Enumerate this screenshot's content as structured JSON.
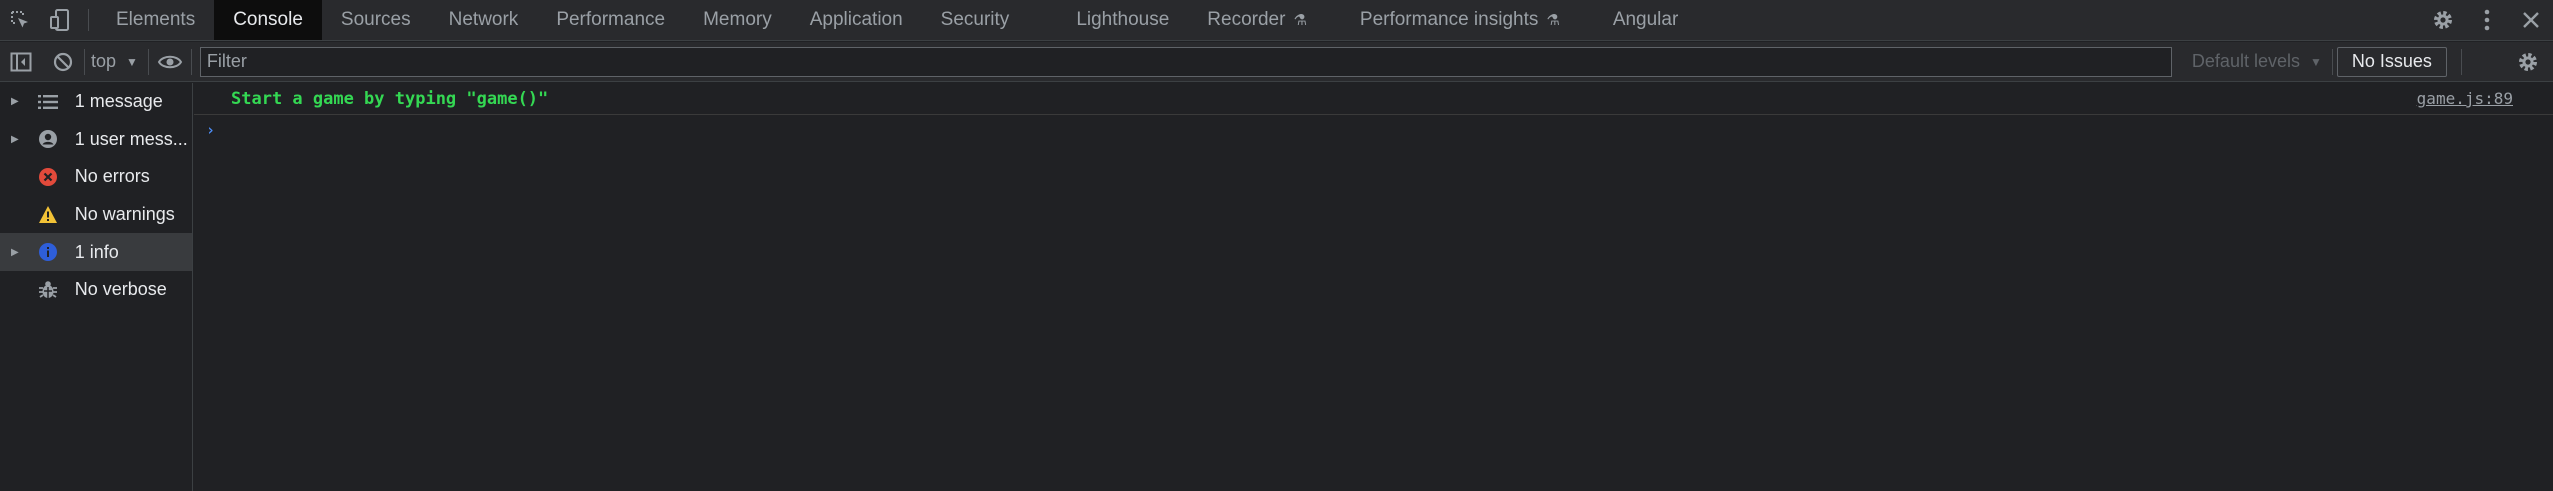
{
  "tabbar": {
    "tabs": [
      {
        "label": "Elements"
      },
      {
        "label": "Console",
        "active": true
      },
      {
        "label": "Sources"
      },
      {
        "label": "Network"
      },
      {
        "label": "Performance"
      },
      {
        "label": "Memory"
      },
      {
        "label": "Application"
      },
      {
        "label": "Security"
      },
      {
        "label": "Lighthouse"
      },
      {
        "label": "Recorder",
        "experimental": true
      },
      {
        "label": "Performance insights",
        "experimental": true
      },
      {
        "label": "Angular"
      }
    ],
    "left_icons": [
      "inspect-element-icon",
      "device-toolbar-icon"
    ],
    "right_icons": [
      "settings-gear-icon",
      "kebab-menu-icon",
      "close-icon"
    ]
  },
  "toolbar": {
    "context": "top",
    "filter_placeholder": "Filter",
    "filter_value": "",
    "levels": "Default levels",
    "issues": "No Issues"
  },
  "sidebar": {
    "items": [
      {
        "label": "1 message",
        "icon": "list-icon",
        "expandable": true
      },
      {
        "label": "1 user mess...",
        "icon": "user-icon",
        "expandable": true
      },
      {
        "label": "No errors",
        "icon": "error-icon",
        "expandable": false
      },
      {
        "label": "No warnings",
        "icon": "warning-icon",
        "expandable": false
      },
      {
        "label": "1 info",
        "icon": "info-icon",
        "expandable": true,
        "selected": true
      },
      {
        "label": "No verbose",
        "icon": "bug-icon",
        "expandable": false
      }
    ]
  },
  "console": {
    "messages": [
      {
        "text": "Start a game by typing \"game()\"",
        "source": "game.js:89"
      }
    ]
  },
  "colors": {
    "background": "#202124",
    "toolbar": "#292a2d",
    "active_tab": "#0d0d0d",
    "message_green": "#34d853",
    "prompt_blue": "#4d8ef7",
    "error_red": "#e24a3b",
    "warning_yellow": "#f2c236",
    "info_blue": "#2e5ed9"
  }
}
